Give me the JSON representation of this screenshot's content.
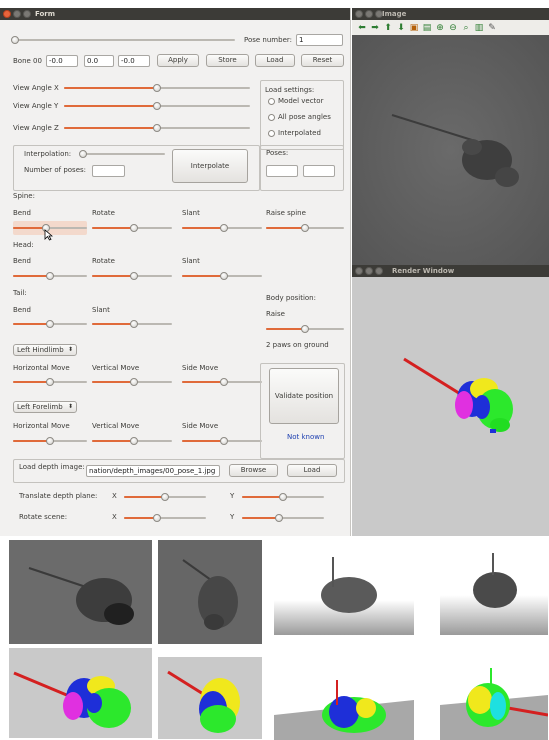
{
  "form_window": {
    "title": "Form",
    "pose_number_label": "Pose number:",
    "pose_number_value": "1",
    "pose_slider": 0.01,
    "bone_label": "Bone 00",
    "bone_values": [
      "-0.0",
      "0.0",
      "-0.0"
    ],
    "buttons": {
      "apply": "Apply",
      "store": "Store",
      "load": "Load",
      "reset": "Reset"
    },
    "view_angles": [
      {
        "label": "View Angle X",
        "value": 0.5
      },
      {
        "label": "View Angle Y",
        "value": 0.5
      },
      {
        "label": "View Angle Z",
        "value": 0.5
      }
    ],
    "load_settings": {
      "title": "Load settings:",
      "options": [
        "Model vector",
        "All pose angles",
        "Interpolated"
      ]
    },
    "interpolation": {
      "label": "Interpolation:",
      "value": 0.0,
      "poses_count_label": "Number of poses:",
      "button": "Interpolate",
      "poses_label": "Poses:"
    },
    "spine": {
      "title": "Spine:",
      "sliders": [
        {
          "label": "Bend",
          "value": 0.45
        },
        {
          "label": "Rotate",
          "value": 0.52
        },
        {
          "label": "Slant",
          "value": 0.52
        },
        {
          "label": "Raise spine",
          "value": 0.5
        }
      ]
    },
    "head": {
      "title": "Head:",
      "sliders": [
        {
          "label": "Bend",
          "value": 0.5
        },
        {
          "label": "Rotate",
          "value": 0.52
        },
        {
          "label": "Slant",
          "value": 0.52
        }
      ]
    },
    "tail": {
      "title": "Tail:",
      "sliders": [
        {
          "label": "Bend",
          "value": 0.5
        },
        {
          "label": "Slant",
          "value": 0.52
        }
      ]
    },
    "body_position": {
      "title": "Body position:",
      "raise_label": "Raise",
      "raise_value": 0.5,
      "paws_text": "2 paws on ground"
    },
    "hindlimb": {
      "combo": "Left Hindlimb",
      "sliders": [
        {
          "label": "Horizontal Move",
          "value": 0.5
        },
        {
          "label": "Vertical Move",
          "value": 0.52
        },
        {
          "label": "Side Move",
          "value": 0.52
        }
      ]
    },
    "forelimb": {
      "combo": "Left Forelimb",
      "sliders": [
        {
          "label": "Horizontal Move",
          "value": 0.5
        },
        {
          "label": "Vertical Move",
          "value": 0.52
        },
        {
          "label": "Side Move",
          "value": 0.52
        }
      ]
    },
    "validate": {
      "button": "Validate position",
      "status": "Not known",
      "status_color": "#1d3fb0"
    },
    "depth": {
      "load_label": "Load depth image:",
      "path": "nation/depth_images/00_pose_1.jpg",
      "browse": "Browse",
      "load": "Load",
      "translate_label": "Translate depth plane:",
      "rotate_label": "Rotate scene:",
      "x_label": "X",
      "y_label": "Y",
      "translate_x": 0.5,
      "translate_y": 0.5,
      "rotate_x": 0.4,
      "rotate_y": 0.45
    },
    "accent_color": "#e06a3a"
  },
  "image_window": {
    "title": "Image",
    "toolbar_icons": [
      "arrow-left-icon",
      "arrow-right-icon",
      "arrow-up-icon",
      "arrow-down-icon",
      "save-image-icon",
      "properties-icon",
      "zoom-in-icon",
      "zoom-out-icon",
      "zoom-fit-icon",
      "save-icon",
      "pin-icon"
    ]
  },
  "render_window": {
    "title": "Render Window"
  }
}
